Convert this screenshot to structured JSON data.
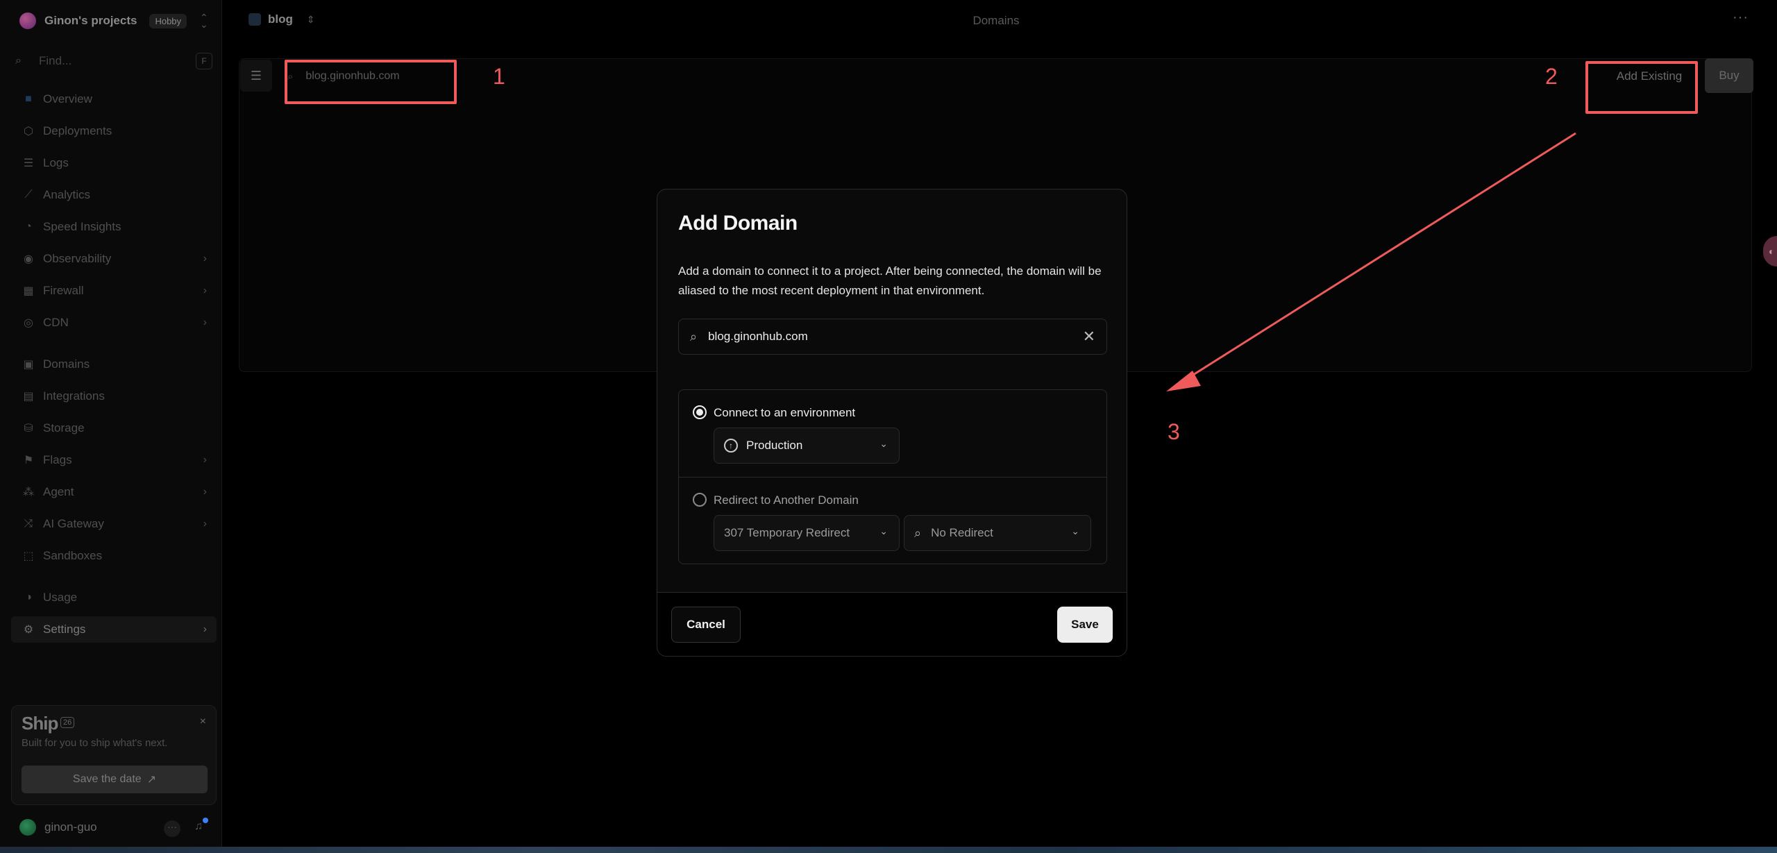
{
  "sidebar": {
    "team_name": "Ginon's projects",
    "team_plan": "Hobby",
    "find_placeholder": "Find...",
    "find_shortcut": "F",
    "items": [
      {
        "label": "Overview",
        "icon": "overview-icon"
      },
      {
        "label": "Deployments",
        "icon": "deployments-icon"
      },
      {
        "label": "Logs",
        "icon": "logs-icon"
      },
      {
        "label": "Analytics",
        "icon": "analytics-icon"
      },
      {
        "label": "Speed Insights",
        "icon": "speed-insights-icon"
      },
      {
        "label": "Observability",
        "icon": "eye-icon"
      },
      {
        "label": "Firewall",
        "icon": "firewall-icon"
      },
      {
        "label": "CDN",
        "icon": "globe-icon"
      },
      {
        "label": "Domains",
        "icon": "domains-icon"
      },
      {
        "label": "Integrations",
        "icon": "integrations-icon"
      },
      {
        "label": "Storage",
        "icon": "database-icon"
      },
      {
        "label": "Flags",
        "icon": "flag-icon"
      },
      {
        "label": "Agent",
        "icon": "agent-icon"
      },
      {
        "label": "AI Gateway",
        "icon": "gateway-icon"
      },
      {
        "label": "Sandboxes",
        "icon": "sandbox-icon"
      },
      {
        "label": "Usage",
        "icon": "usage-icon"
      },
      {
        "label": "Settings",
        "icon": "gear-icon"
      }
    ],
    "ship": {
      "title": "Ship",
      "badge": "26",
      "subtitle": "Built for you to ship what's next.",
      "button": "Save the date"
    },
    "user_name": "ginon-guo"
  },
  "topbar": {
    "project": "blog",
    "page_title": "Domains"
  },
  "domains_page": {
    "search_value": "blog.ginonhub.com",
    "add_existing": "Add Existing",
    "buy": "Buy"
  },
  "annotations": {
    "color": "#ef5b5b",
    "labels": [
      "1",
      "2",
      "3"
    ]
  },
  "modal": {
    "title": "Add Domain",
    "description": "Add a domain to connect it to a project. After being connected, the domain will be aliased to the most recent deployment in that environment.",
    "search_value": "blog.ginonhub.com",
    "option_connect": "Connect to an environment",
    "environment": "Production",
    "option_redirect": "Redirect to Another Domain",
    "redirect_type": "307 Temporary Redirect",
    "redirect_target": "No Redirect",
    "cancel": "Cancel",
    "save": "Save"
  }
}
